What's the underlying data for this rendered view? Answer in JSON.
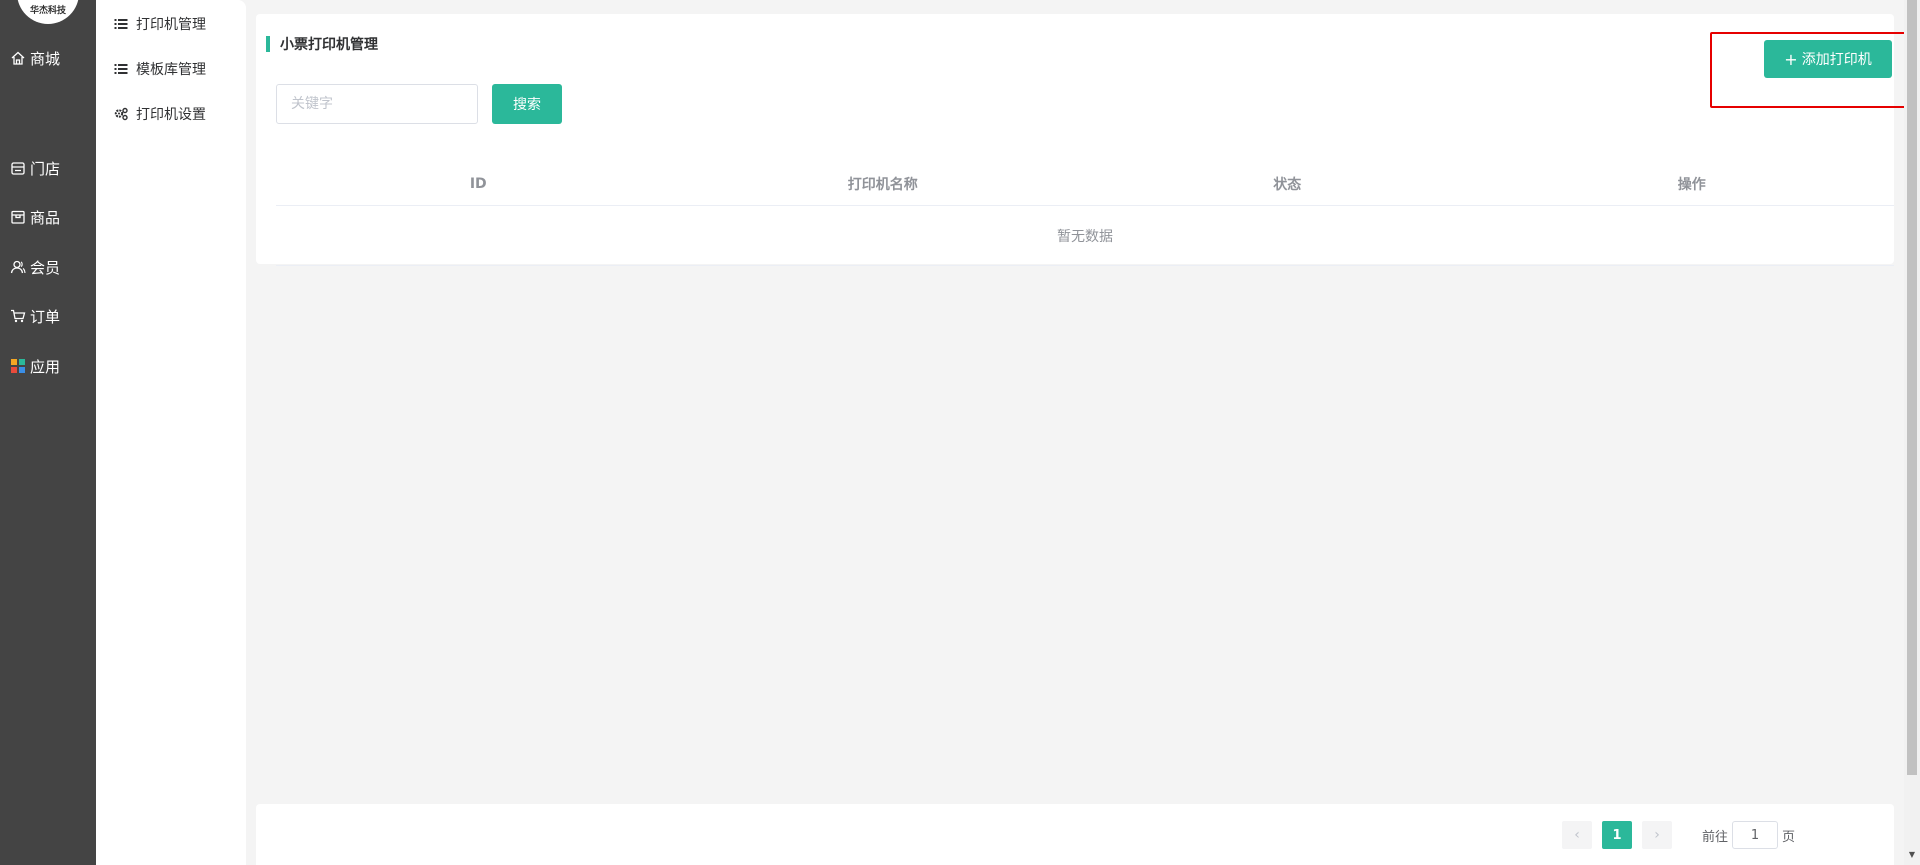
{
  "logo": {
    "text": "华杰科技"
  },
  "nav": {
    "items": [
      {
        "label": "商城",
        "icon": "home-icon"
      },
      {
        "label": "门店",
        "icon": "store-icon"
      },
      {
        "label": "商品",
        "icon": "goods-icon"
      },
      {
        "label": "会员",
        "icon": "member-icon"
      },
      {
        "label": "订单",
        "icon": "cart-icon"
      },
      {
        "label": "应用",
        "icon": "apps-icon"
      }
    ]
  },
  "submenu": {
    "items": [
      {
        "label": "打印机管理",
        "icon": "list-icon"
      },
      {
        "label": "模板库管理",
        "icon": "list-icon"
      },
      {
        "label": "打印机设置",
        "icon": "gears-icon"
      }
    ]
  },
  "page": {
    "title": "小票打印机管理",
    "add_button": "添加打印机",
    "search_placeholder": "关键字",
    "search_button": "搜索"
  },
  "table": {
    "columns": [
      "ID",
      "打印机名称",
      "状态",
      "操作"
    ],
    "empty_text": "暂无数据"
  },
  "pagination": {
    "current_page": "1",
    "goto_label": "前往",
    "goto_value": "1",
    "goto_suffix": "页"
  },
  "colors": {
    "accent": "#2bb89a",
    "nav_bg": "#444444",
    "highlight": "#e60000"
  }
}
